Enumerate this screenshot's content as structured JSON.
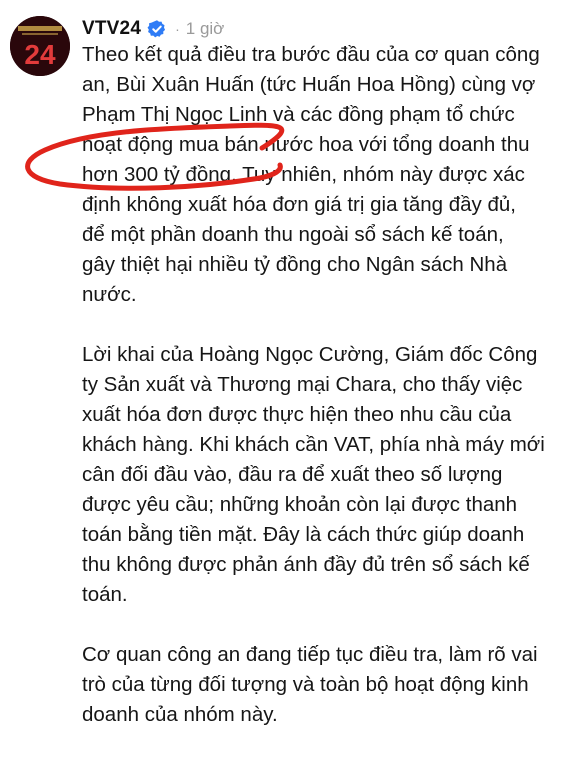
{
  "post": {
    "username": "VTV24",
    "time_ago": "1 giờ",
    "separator": "·",
    "verified_icon": "verified-badge-icon",
    "avatar_text": "24",
    "paragraphs": [
      "Theo kết quả điều tra bước đầu của cơ quan công\nan, Bùi Xuân Huấn (tức Huấn Hoa Hồng) cùng vợ\nPhạm Thị Ngọc Linh và các đồng phạm tổ chức\nhoạt động mua bán nước hoa với tổng doanh thu\nhơn 300 tỷ đồng. Tuy nhiên, nhóm này được xác\nđịnh không xuất hóa đơn giá trị gia tăng đầy đủ,\nđể một phần doanh thu ngoài sổ sách kế toán,\ngây thiệt hại nhiều tỷ đồng cho Ngân sách Nhà\nnước.",
      "Lời khai của Hoàng Ngọc Cường, Giám đốc Công\nty Sản xuất và Thương mại Chara, cho thấy việc\nxuất hóa đơn được thực hiện theo nhu cầu của\nkhách hàng. Khi khách cần VAT, phía nhà máy mới\ncân đối đầu vào, đầu ra để xuất theo số lượng\nđược yêu cầu; những khoản còn lại được thanh\ntoán bằng tiền mặt. Đây là cách thức giúp doanh\nthu không được phản ánh đầy đủ trên sổ sách kế\ntoán.",
      "Cơ quan công an đang tiếp tục điều tra, làm rõ vai\ntrò của từng đối tượng và toàn bộ hoạt động kinh\ndoanh của nhóm này."
    ]
  },
  "colors": {
    "annotation": "#e0241b",
    "verified": "#2f7cf6",
    "muted": "#9a9a9a"
  }
}
